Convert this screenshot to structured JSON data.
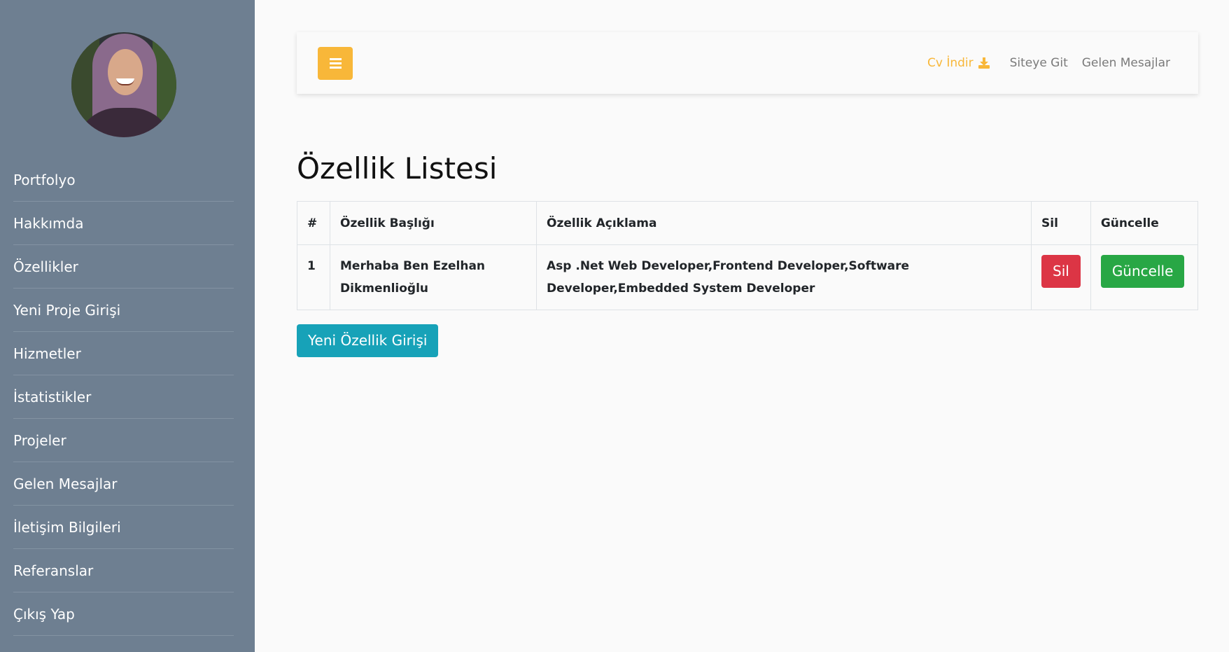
{
  "sidebar": {
    "items": [
      {
        "label": "Portfolyo"
      },
      {
        "label": "Hakkımda"
      },
      {
        "label": "Özellikler"
      },
      {
        "label": "Yeni Proje Girişi"
      },
      {
        "label": "Hizmetler"
      },
      {
        "label": "İstatistikler"
      },
      {
        "label": "Projeler"
      },
      {
        "label": "Gelen Mesajlar"
      },
      {
        "label": "İletişim Bilgileri"
      },
      {
        "label": "Referanslar"
      },
      {
        "label": "Çıkış Yap"
      }
    ]
  },
  "topbar": {
    "cv_label": "Cv İndir",
    "site_label": "Siteye Git",
    "messages_label": "Gelen Mesajlar",
    "menu_icon": "bars-icon",
    "download_icon": "download-icon"
  },
  "main": {
    "title": "Özellik Listesi",
    "table": {
      "headers": [
        "#",
        "Özellik Başlığı",
        "Özellik Açıklama",
        "Sil",
        "Güncelle"
      ],
      "rows": [
        {
          "id": "1",
          "title": "Merhaba Ben Ezelhan Dikmenlioğlu",
          "description": "Asp .Net Web Developer,Frontend Developer,Software Developer,Embedded System Developer",
          "delete_label": "Sil",
          "update_label": "Güncelle"
        }
      ]
    },
    "new_button": "Yeni Özellik Girişi"
  },
  "colors": {
    "sidebar": "#6e7f91",
    "accent": "#f8b739",
    "danger": "#dc3545",
    "success": "#28a745",
    "info": "#17a2b8"
  }
}
